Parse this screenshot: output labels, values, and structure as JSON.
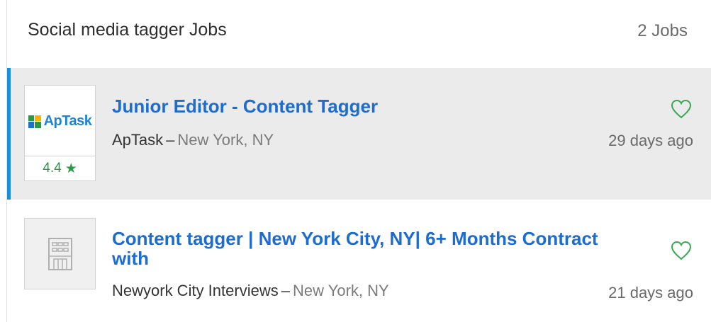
{
  "header": {
    "title": "Social media tagger Jobs",
    "count": "2 Jobs"
  },
  "jobs": [
    {
      "title": "Junior Editor - Content Tagger",
      "company": "ApTask",
      "separator": "–",
      "location": "New York, NY",
      "posted": "29 days ago",
      "selected": true,
      "logo": {
        "type": "brand",
        "text": "ApTask"
      },
      "rating": {
        "value": "4.4",
        "star": "★"
      }
    },
    {
      "title": "Content tagger | New York City, NY| 6+ Months Contract with",
      "company": "Newyork City Interviews",
      "separator": "–",
      "location": "New York, NY",
      "posted": "21 days ago",
      "selected": false,
      "logo": {
        "type": "placeholder",
        "icon": "building-icon"
      }
    }
  ],
  "colors": {
    "accent": "#1a8dd8",
    "title": "#1d6ccf",
    "heart": "#3aa852",
    "rating": "#2a9a46",
    "selectedBg": "#ebebeb"
  },
  "icons": {
    "save": "heart-icon",
    "placeholder_logo": "building-icon",
    "rating": "star-icon"
  }
}
